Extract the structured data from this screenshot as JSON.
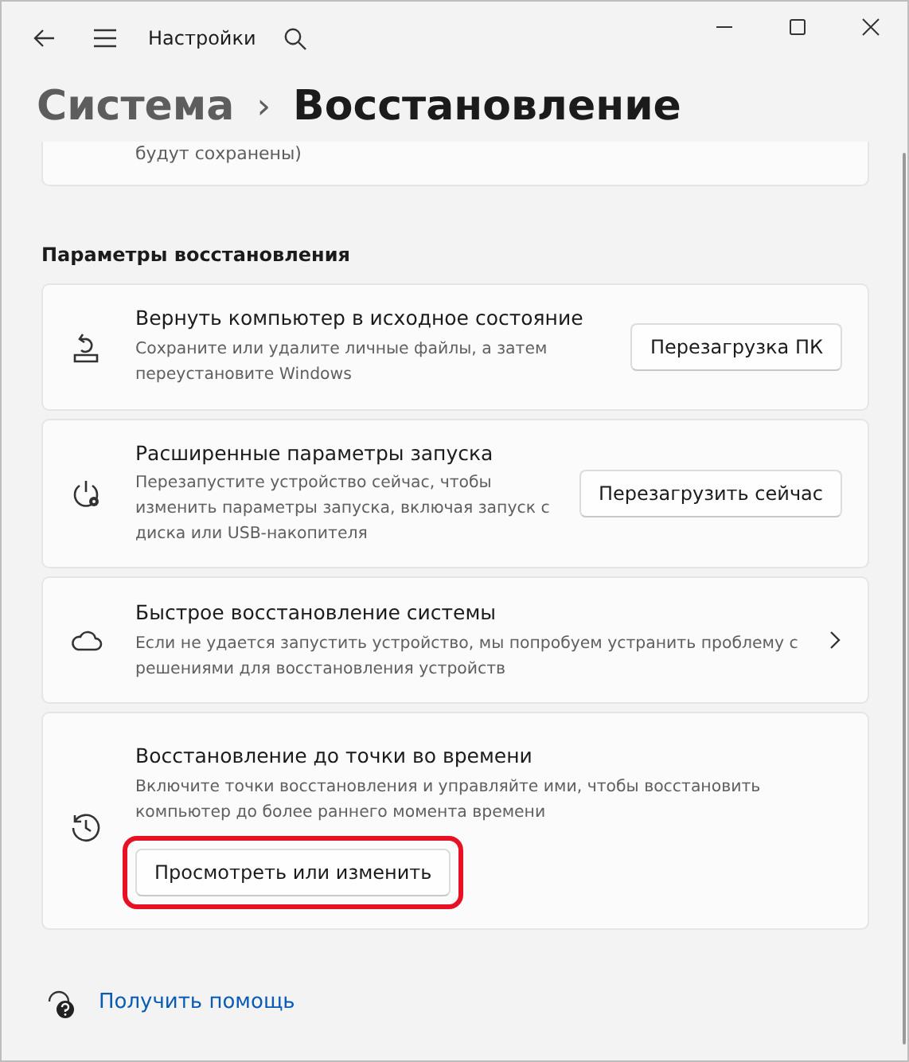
{
  "window": {
    "title": "Настройки"
  },
  "breadcrumb": {
    "parent": "Система",
    "separator": "›",
    "current": "Восстановление"
  },
  "partial_card": {
    "text": "будут сохранены)"
  },
  "section": {
    "title": "Параметры восстановления"
  },
  "options": [
    {
      "kind": "button",
      "title": "Вернуть компьютер в исходное состояние",
      "description": "Сохраните или удалите личные файлы, а затем переустановите Windows",
      "button": "Перезагрузка ПК",
      "highlighted": false
    },
    {
      "kind": "button",
      "title": "Расширенные параметры запуска",
      "description": "Перезапустите устройство сейчас, чтобы изменить параметры запуска, включая запуск с диска или USB-накопителя",
      "button": "Перезагрузить сейчас",
      "highlighted": false
    },
    {
      "kind": "chevron",
      "title": "Быстрое восстановление системы",
      "description": "Если не удается запустить устройство, мы попробуем устранить проблему с решениями для восстановления устройств"
    },
    {
      "kind": "button_below",
      "title": "Восстановление до точки во времени",
      "description": "Включите точки восстановления и управляйте ими, чтобы восстановить компьютер до более раннего момента времени",
      "button": "Просмотреть или изменить",
      "highlighted": true
    }
  ],
  "help": {
    "label": "Получить помощь"
  }
}
